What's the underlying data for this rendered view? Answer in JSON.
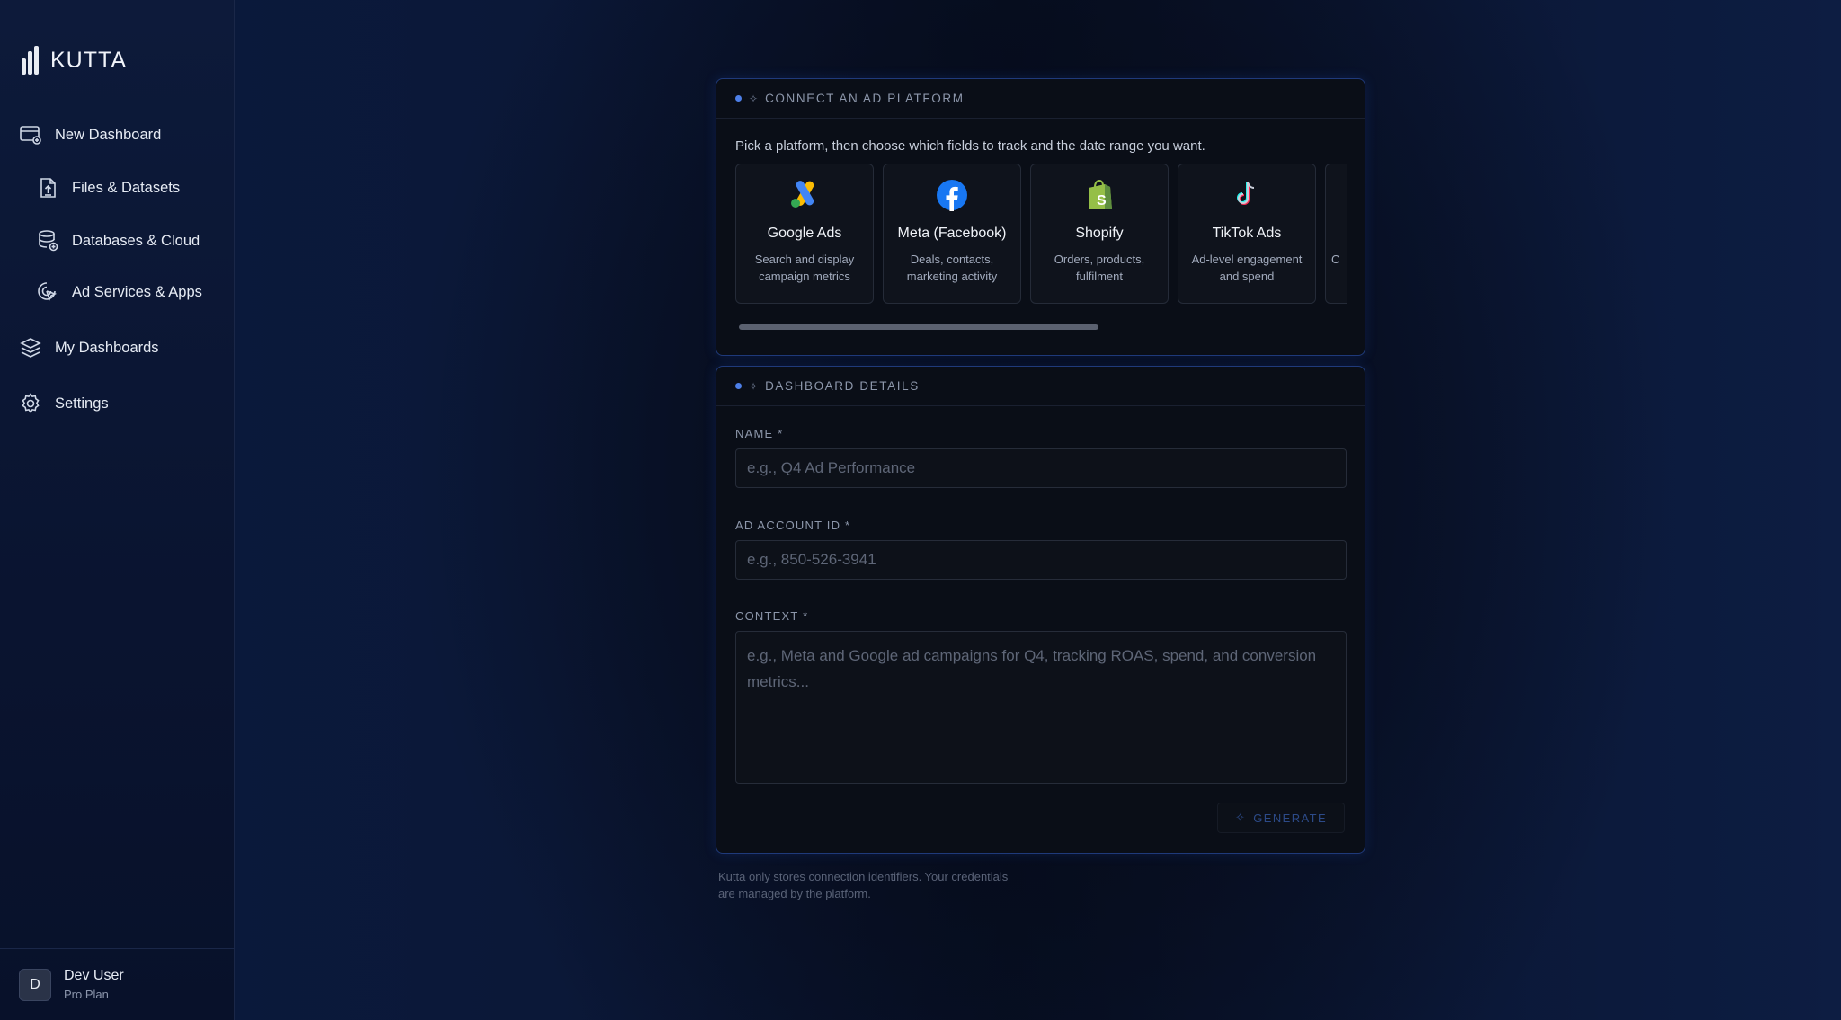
{
  "brand": {
    "name": "KUTTA"
  },
  "sidebar": {
    "items": [
      {
        "label": "New Dashboard",
        "icon": "new-dashboard-icon"
      },
      {
        "label": "Files & Datasets",
        "icon": "file-upload-icon"
      },
      {
        "label": "Databases & Cloud",
        "icon": "database-icon"
      },
      {
        "label": "Ad Services & Apps",
        "icon": "ad-services-icon"
      },
      {
        "label": "My Dashboards",
        "icon": "layers-icon"
      },
      {
        "label": "Settings",
        "icon": "gear-icon"
      }
    ]
  },
  "user": {
    "initial": "D",
    "name": "Dev User",
    "plan": "Pro Plan"
  },
  "connect": {
    "title": "CONNECT AN AD PLATFORM",
    "intro": "Pick a platform, then choose which fields to track and the date range you want.",
    "platforms": [
      {
        "name": "Google Ads",
        "desc": "Search and display campaign metrics",
        "icon": "google-ads-icon"
      },
      {
        "name": "Meta (Facebook)",
        "desc": "Deals, contacts, marketing activity",
        "icon": "facebook-icon"
      },
      {
        "name": "Shopify",
        "desc": "Orders, products, fulfilment",
        "icon": "shopify-icon"
      },
      {
        "name": "TikTok Ads",
        "desc": "Ad-level engagement and spend",
        "icon": "tiktok-icon"
      },
      {
        "name": "",
        "desc": "C",
        "icon": ""
      }
    ]
  },
  "details": {
    "title": "DASHBOARD DETAILS",
    "name_label": "NAME *",
    "name_placeholder": "e.g., Q4 Ad Performance",
    "account_label": "AD ACCOUNT ID *",
    "account_placeholder": "e.g., 850-526-3941",
    "context_label": "CONTEXT *",
    "context_placeholder": "e.g., Meta and Google ad campaigns for Q4, tracking ROAS, spend, and conversion metrics...",
    "generate_label": "GENERATE"
  },
  "footnote": "Kutta only stores connection identifiers. Your credentials are managed by the platform.",
  "colors": {
    "accent": "#4d7fe8",
    "panel_border": "#1f3a7a",
    "background": "#060b1a"
  }
}
